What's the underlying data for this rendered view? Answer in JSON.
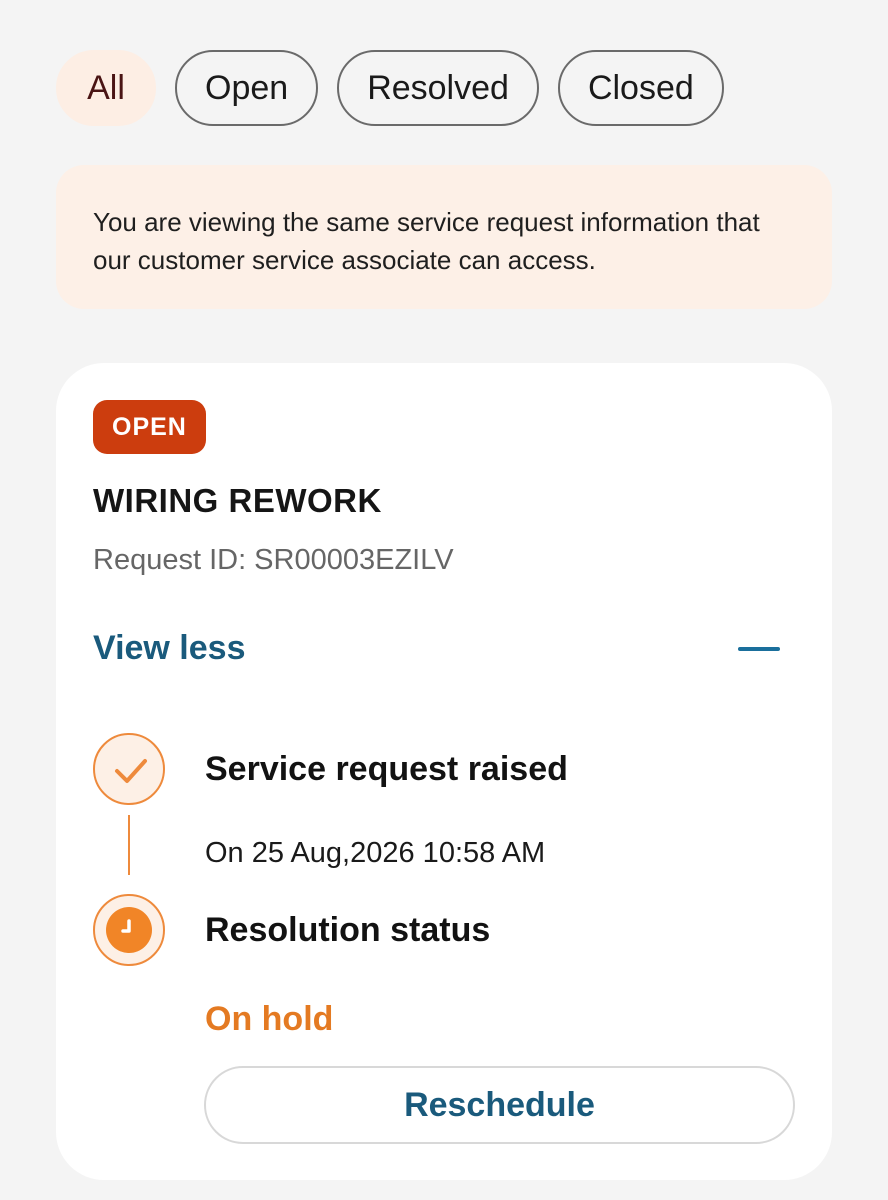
{
  "filters": [
    {
      "label": "All",
      "active": true
    },
    {
      "label": "Open",
      "active": false
    },
    {
      "label": "Resolved",
      "active": false
    },
    {
      "label": "Closed",
      "active": false
    }
  ],
  "notice": {
    "text": "You are viewing the same service request information that our customer service associate can access."
  },
  "request": {
    "status_badge": "OPEN",
    "title": "WIRING REWORK",
    "request_id": "Request ID: SR00003EZILV",
    "toggle_label": "View less",
    "timeline": [
      {
        "title": "Service request raised",
        "detail": "On 25 Aug,2026 10:58 AM",
        "icon": "checkmark-icon"
      },
      {
        "title": "Resolution status",
        "detail": "On hold",
        "icon": "clock-icon"
      }
    ],
    "action_label": "Reschedule"
  },
  "colors": {
    "accent_orange": "#ee8a3c",
    "badge_red": "#cc3d0e",
    "link_blue": "#1a5a7c",
    "status_orange": "#e47a22"
  }
}
